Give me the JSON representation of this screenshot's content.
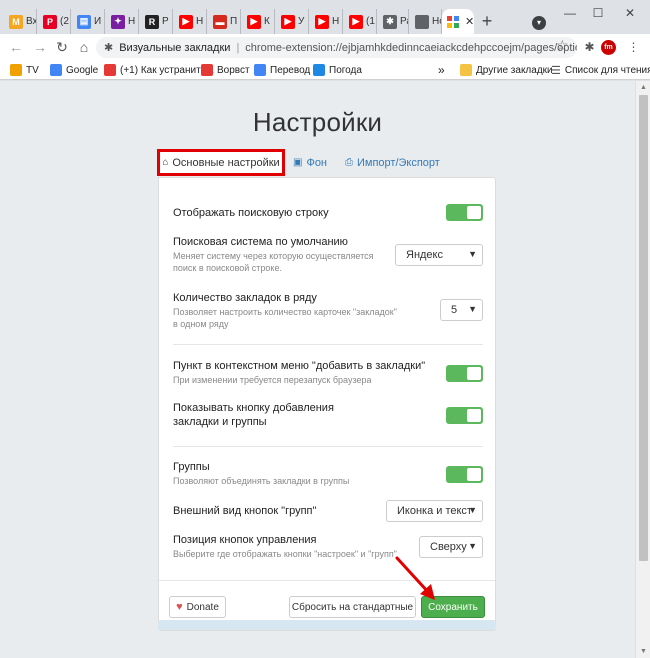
{
  "browser": {
    "tabs": [
      {
        "label": "Вх",
        "color": "#f5a623",
        "glyph": "M"
      },
      {
        "label": "(2",
        "color": "#e60023",
        "glyph": "P"
      },
      {
        "label": "И",
        "color": "#4285f4",
        "glyph": "▤"
      },
      {
        "label": "Н",
        "color": "#7b1fa2",
        "glyph": "✦"
      },
      {
        "label": "Р",
        "color": "#222222",
        "glyph": "R"
      },
      {
        "label": "Н",
        "color": "#ff0000",
        "glyph": "▶"
      },
      {
        "label": "П",
        "color": "#d52b1e",
        "glyph": "▬"
      },
      {
        "label": "К",
        "color": "#ff0000",
        "glyph": "▶"
      },
      {
        "label": "У",
        "color": "#ff0000",
        "glyph": "▶"
      },
      {
        "label": "Н",
        "color": "#ff0000",
        "glyph": "▶"
      },
      {
        "label": "(1",
        "color": "#ff0000",
        "glyph": "▶"
      },
      {
        "label": "Ра",
        "color": "#5f6368",
        "glyph": "✱"
      },
      {
        "label": "Нова",
        "color": "#5f6368",
        "glyph": ""
      }
    ],
    "active_tab": {
      "label": "",
      "close": "✕"
    },
    "new_tab": "+",
    "window_controls": {
      "minimize": "—",
      "maximize": "☐",
      "close": "✕"
    },
    "address_bar": {
      "site_name": "Визуальные закладки",
      "separator": "|",
      "url": "chrome-extension://ejbjamhkdedinncaeiackcdehpccoejm/pages/options.html"
    },
    "bookmarks": [
      {
        "label": "TV",
        "color": "#f0a000"
      },
      {
        "label": "Google",
        "color": "#4285f4"
      },
      {
        "label": "(+1) Как устранить...",
        "color": "#e53935"
      },
      {
        "label": "Ворвст",
        "color": "#e53935"
      },
      {
        "label": "Перевод",
        "color": "#4285f4"
      },
      {
        "label": "Погода",
        "color": "#1e88e5"
      }
    ],
    "bookmarks_overflow": "»",
    "other_bookmarks": "Другие закладки",
    "reading_list": "Список для чтения"
  },
  "page": {
    "title": "Настройки",
    "tabs": [
      {
        "icon": "⌂",
        "label": "Основные настройки"
      },
      {
        "icon": "▣",
        "label": "Фон"
      },
      {
        "icon": "⎙",
        "label": "Импорт/Экспорт"
      }
    ],
    "settings": {
      "search_bar": {
        "title": "Отображать поисковую строку",
        "enabled": true
      },
      "search_engine": {
        "title": "Поисковая система по умолчанию",
        "desc": "Меняет систему через которую осуществляется поиск в поисковой строке.",
        "value": "Яндекс"
      },
      "bookmark_count": {
        "title": "Количество закладок в ряду",
        "desc": "Позволяет настроить количество карточек \"закладок\" в одном ряду",
        "value": "5"
      },
      "context_menu": {
        "title": "Пункт в контекстном меню \"добавить в закладки\"",
        "desc": "При изменении требуется перезапуск браузера",
        "enabled": true
      },
      "add_button": {
        "title": "Показывать кнопку добавления закладки и группы",
        "enabled": true
      },
      "groups": {
        "title": "Группы",
        "desc": "Позволяют объединять закладки в группы",
        "enabled": true
      },
      "group_buttons_look": {
        "title": "Внешний вид кнопок \"групп\"",
        "value": "Иконка и текст"
      },
      "control_position": {
        "title": "Позиция кнопок управления",
        "desc": "Выберите где отображать кнопки \"настроек\" и \"групп\"",
        "value": "Сверху"
      }
    },
    "buttons": {
      "donate": "Donate",
      "reset": "Сбросить на стандартные",
      "save": "Сохранить"
    }
  },
  "colors": {
    "toggle_on": "#5cb85c",
    "save_button": "#4cae4c",
    "highlight_box": "#e00000",
    "annotation_arrow": "#e00000",
    "link": "#337ab7"
  }
}
